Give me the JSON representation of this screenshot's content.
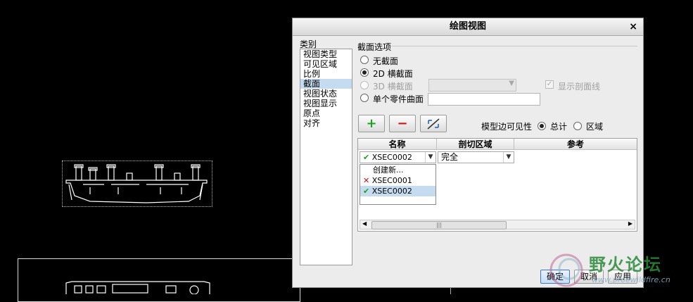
{
  "dialog": {
    "title": "绘图视图",
    "close": "×",
    "category_label": "类别",
    "categories": [
      "视图类型",
      "可见区域",
      "比例",
      "截面",
      "视图状态",
      "视图显示",
      "原点",
      "对齐"
    ],
    "section_options_title": "截面选项",
    "options": {
      "none": "无截面",
      "sec2d": "2D 横截面",
      "sec3d": "3D 横截面",
      "single_part": "单个零件曲面"
    },
    "show_xhatch": "显示剖面线",
    "add_symbol": "+",
    "remove_symbol": "−",
    "model_edge_visibility": "模型边可见性",
    "vis_total": "总计",
    "vis_area": "区域",
    "table": {
      "columns": [
        "名称",
        "剖切区域",
        "参考"
      ],
      "row": {
        "name": "XSEC0002",
        "area": "完全"
      },
      "dropdown": [
        "创建新...",
        "XSEC0001",
        "XSEC0002"
      ]
    },
    "buttons": {
      "ok": "确定",
      "cancel": "取消",
      "apply": "应用"
    }
  },
  "watermark": {
    "title": "野火论坛",
    "url": "www.proewildfire.cn"
  },
  "colors": {
    "accent": "#c5dcf0",
    "ok_green": "#1ea21e",
    "remove_red": "#d01010"
  }
}
